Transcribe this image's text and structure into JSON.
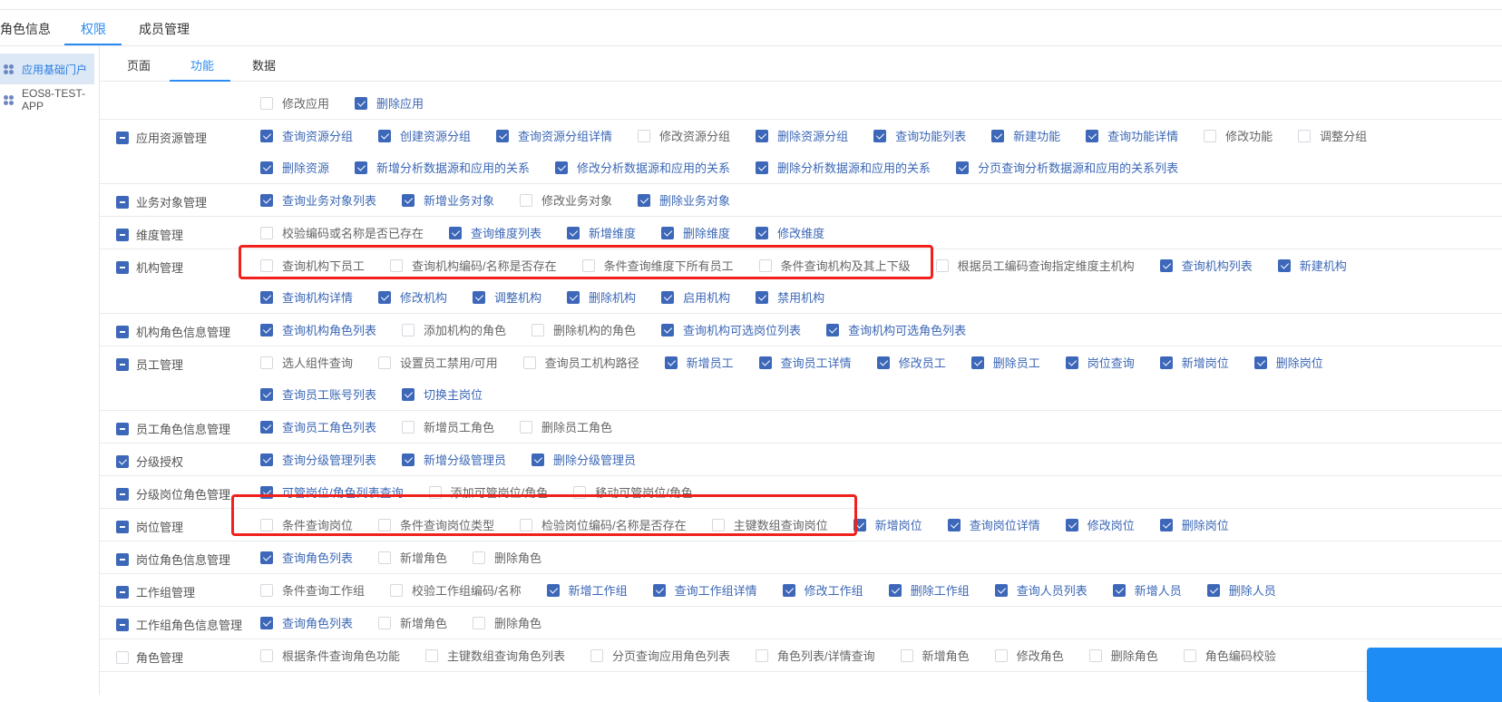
{
  "tabs": [
    {
      "label": "角色信息"
    },
    {
      "label": "权限",
      "active": true
    },
    {
      "label": "成员管理"
    }
  ],
  "sidebar": {
    "items": [
      {
        "label": "应用基础门户",
        "active": true,
        "icon": "app-grid-icon"
      },
      {
        "label": "EOS8-TEST-APP",
        "icon": "app-grid-icon"
      }
    ]
  },
  "subtabs": [
    {
      "label": "页面"
    },
    {
      "label": "功能",
      "active": true
    },
    {
      "label": "数据"
    }
  ],
  "colors": {
    "accent": "#2a8cf0",
    "checkbox": "#3d67b8",
    "checked_text": "#3b67b6",
    "highlight_box": "#f0211d"
  },
  "groups": [
    {
      "label": "",
      "state": "none",
      "lines": [
        [
          [
            "修改应用",
            false
          ],
          [
            "删除应用",
            true
          ]
        ]
      ]
    },
    {
      "label": "应用资源管理",
      "state": "indeterminate",
      "lines": [
        [
          [
            "查询资源分组",
            true
          ],
          [
            "创建资源分组",
            true
          ],
          [
            "查询资源分组详情",
            true
          ],
          [
            "修改资源分组",
            false
          ],
          [
            "删除资源分组",
            true
          ],
          [
            "查询功能列表",
            true
          ],
          [
            "新建功能",
            true
          ],
          [
            "查询功能详情",
            true
          ],
          [
            "修改功能",
            false
          ],
          [
            "调整分组",
            false
          ]
        ],
        [
          [
            "删除资源",
            true
          ],
          [
            "新增分析数据源和应用的关系",
            true
          ],
          [
            "修改分析数据源和应用的关系",
            true
          ],
          [
            "删除分析数据源和应用的关系",
            true
          ],
          [
            "分页查询分析数据源和应用的关系列表",
            true
          ]
        ]
      ]
    },
    {
      "label": "业务对象管理",
      "state": "indeterminate",
      "lines": [
        [
          [
            "查询业务对象列表",
            true
          ],
          [
            "新增业务对象",
            true
          ],
          [
            "修改业务对象",
            false
          ],
          [
            "删除业务对象",
            true
          ]
        ]
      ]
    },
    {
      "label": "维度管理",
      "state": "indeterminate",
      "lines": [
        [
          [
            "校验编码或名称是否已存在",
            false
          ],
          [
            "查询维度列表",
            true
          ],
          [
            "新增维度",
            true
          ],
          [
            "删除维度",
            true
          ],
          [
            "修改维度",
            true
          ]
        ]
      ]
    },
    {
      "label": "机构管理",
      "state": "indeterminate",
      "lines": [
        [
          [
            "查询机构下员工",
            false
          ],
          [
            "查询机构编码/名称是否存在",
            false
          ],
          [
            "条件查询维度下所有员工",
            false
          ],
          [
            "条件查询机构及其上下级",
            false
          ],
          [
            "根据员工编码查询指定维度主机构",
            false
          ],
          [
            "查询机构列表",
            true
          ],
          [
            "新建机构",
            true
          ]
        ],
        [
          [
            "查询机构详情",
            true
          ],
          [
            "修改机构",
            true
          ],
          [
            "调整机构",
            true
          ],
          [
            "删除机构",
            true
          ],
          [
            "启用机构",
            true
          ],
          [
            "禁用机构",
            true
          ]
        ]
      ]
    },
    {
      "label": "机构角色信息管理",
      "state": "indeterminate",
      "lines": [
        [
          [
            "查询机构角色列表",
            true
          ],
          [
            "添加机构的角色",
            false
          ],
          [
            "删除机构的角色",
            false
          ],
          [
            "查询机构可选岗位列表",
            true
          ],
          [
            "查询机构可选角色列表",
            true
          ]
        ]
      ]
    },
    {
      "label": "员工管理",
      "state": "indeterminate",
      "lines": [
        [
          [
            "选人组件查询",
            false
          ],
          [
            "设置员工禁用/可用",
            false
          ],
          [
            "查询员工机构路径",
            false
          ],
          [
            "新增员工",
            true
          ],
          [
            "查询员工详情",
            true
          ],
          [
            "修改员工",
            true
          ],
          [
            "删除员工",
            true
          ],
          [
            "岗位查询",
            true
          ],
          [
            "新增岗位",
            true
          ],
          [
            "删除岗位",
            true
          ]
        ],
        [
          [
            "查询员工账号列表",
            true
          ],
          [
            "切换主岗位",
            true
          ]
        ]
      ]
    },
    {
      "label": "员工角色信息管理",
      "state": "indeterminate",
      "lines": [
        [
          [
            "查询员工角色列表",
            true
          ],
          [
            "新增员工角色",
            false
          ],
          [
            "删除员工角色",
            false
          ]
        ]
      ]
    },
    {
      "label": "分级授权",
      "state": "checked",
      "lines": [
        [
          [
            "查询分级管理列表",
            true
          ],
          [
            "新增分级管理员",
            true
          ],
          [
            "删除分级管理员",
            true
          ]
        ]
      ]
    },
    {
      "label": "分级岗位角色管理",
      "state": "indeterminate",
      "lines": [
        [
          [
            "可管岗位/角色列表查询",
            true
          ],
          [
            "添加可管岗位/角色",
            false
          ],
          [
            "移动可管岗位/角色",
            false
          ]
        ]
      ]
    },
    {
      "label": "岗位管理",
      "state": "indeterminate",
      "lines": [
        [
          [
            "条件查询岗位",
            false
          ],
          [
            "条件查询岗位类型",
            false
          ],
          [
            "检验岗位编码/名称是否存在",
            false
          ],
          [
            "主键数组查询岗位",
            false
          ],
          [
            "新增岗位",
            true
          ],
          [
            "查询岗位详情",
            true
          ],
          [
            "修改岗位",
            true
          ],
          [
            "删除岗位",
            true
          ]
        ]
      ]
    },
    {
      "label": "岗位角色信息管理",
      "state": "indeterminate",
      "lines": [
        [
          [
            "查询角色列表",
            true
          ],
          [
            "新增角色",
            false
          ],
          [
            "删除角色",
            false
          ]
        ]
      ]
    },
    {
      "label": "工作组管理",
      "state": "indeterminate",
      "lines": [
        [
          [
            "条件查询工作组",
            false
          ],
          [
            "校验工作组编码/名称",
            false
          ],
          [
            "新增工作组",
            true
          ],
          [
            "查询工作组详情",
            true
          ],
          [
            "修改工作组",
            true
          ],
          [
            "删除工作组",
            true
          ],
          [
            "查询人员列表",
            true
          ],
          [
            "新增人员",
            true
          ],
          [
            "删除人员",
            true
          ]
        ]
      ]
    },
    {
      "label": "工作组角色信息管理",
      "state": "indeterminate",
      "lines": [
        [
          [
            "查询角色列表",
            true
          ],
          [
            "新增角色",
            false
          ],
          [
            "删除角色",
            false
          ]
        ]
      ]
    },
    {
      "label": "角色管理",
      "state": "unchecked",
      "lines": [
        [
          [
            "根据条件查询角色功能",
            false
          ],
          [
            "主键数组查询角色列表",
            false
          ],
          [
            "分页查询应用角色列表",
            false
          ],
          [
            "角色列表/详情查询",
            false
          ],
          [
            "新增角色",
            false
          ],
          [
            "修改角色",
            false
          ],
          [
            "删除角色",
            false
          ],
          [
            "角色编码校验",
            false
          ]
        ]
      ]
    }
  ]
}
